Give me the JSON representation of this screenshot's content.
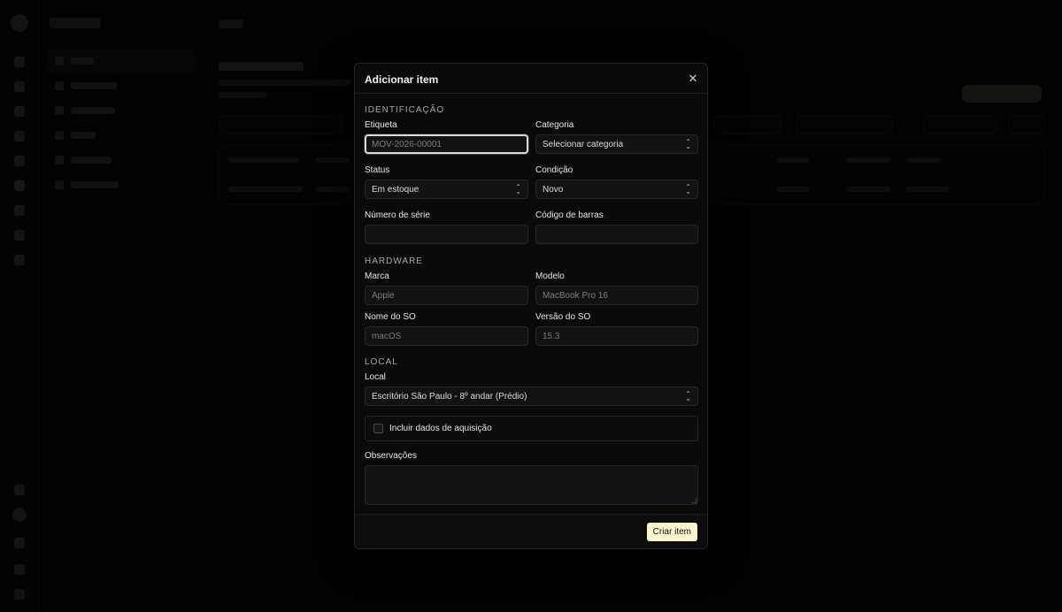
{
  "modal": {
    "title": "Adicionar item",
    "close_icon": "close-icon",
    "sections": {
      "identification": "IDENTIFICAÇÃO",
      "hardware": "HARDWARE",
      "location": "LOCAL"
    },
    "fields": {
      "tag": {
        "label": "Etiqueta",
        "placeholder": "MOV-2026-00001",
        "value": ""
      },
      "category": {
        "label": "Categoria",
        "value": "Selecionar categoria"
      },
      "status": {
        "label": "Status",
        "value": "Em estoque"
      },
      "condition": {
        "label": "Condição",
        "value": "Novo"
      },
      "serial": {
        "label": "Número de série",
        "value": ""
      },
      "barcode": {
        "label": "Código de barras",
        "value": ""
      },
      "brand": {
        "label": "Marca",
        "placeholder": "Apple"
      },
      "model": {
        "label": "Modelo",
        "placeholder": "MacBook Pro 16"
      },
      "os_name": {
        "label": "Nome do SO",
        "placeholder": "macOS"
      },
      "os_version": {
        "label": "Versão do SO",
        "placeholder": "15.3"
      },
      "location": {
        "label": "Local",
        "value": "Escritório São Paulo - 8º andar (Prédio)"
      },
      "acquisition": {
        "label": "Incluir dados de aquisição",
        "checked": false
      },
      "notes": {
        "label": "Observações",
        "value": ""
      }
    },
    "submit_label": "Criar item"
  },
  "colors": {
    "primary_button": "#fbf5cf",
    "modal_bg": "#0a0a0a",
    "border": "#262626"
  }
}
